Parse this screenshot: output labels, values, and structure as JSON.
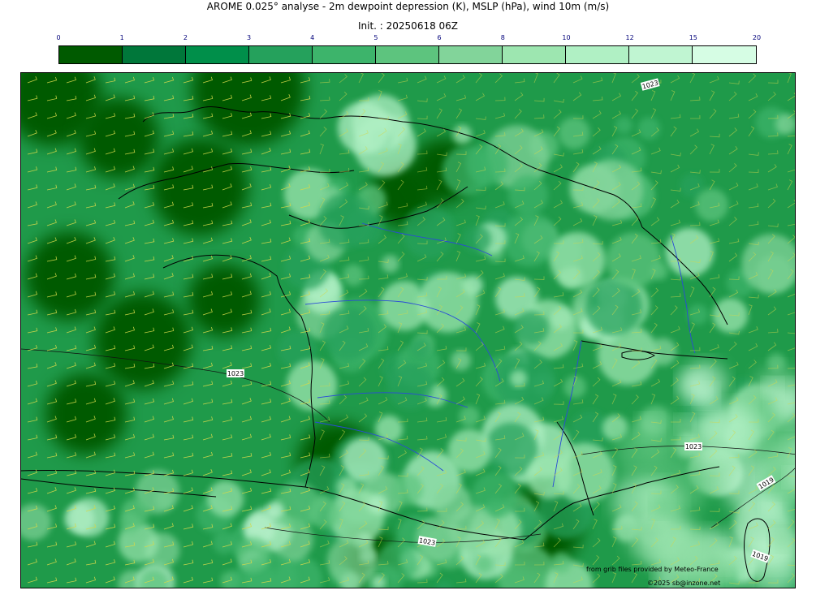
{
  "header": {
    "title": "AROME 0.025° analyse - 2m dewpoint depression (K), MSLP (hPa), wind 10m (m/s)",
    "init": "Init. : 20250618 06Z"
  },
  "colorbar": {
    "ticks": [
      "0",
      "1",
      "2",
      "3",
      "4",
      "5",
      "6",
      "8",
      "10",
      "12",
      "15",
      "20"
    ],
    "colors": [
      "#005a00",
      "#00773a",
      "#008f4a",
      "#25a15c",
      "#3db46b",
      "#5dc47e",
      "#82d49a",
      "#9de6b0",
      "#b0f0c4",
      "#c0f5d2",
      "#d6fde4"
    ]
  },
  "map": {
    "isobar_labels": [
      "1023",
      "1023",
      "1023",
      "1023",
      "1019",
      "1019"
    ],
    "colors": {
      "sea": "#0a8a3a",
      "coast": "#000000",
      "river": "#2a4bd7",
      "barb": "#d4d84a"
    }
  },
  "credits": {
    "line1": "from grib files provided by Meteo-France",
    "line2": "©2025 sb@inzone.net"
  }
}
